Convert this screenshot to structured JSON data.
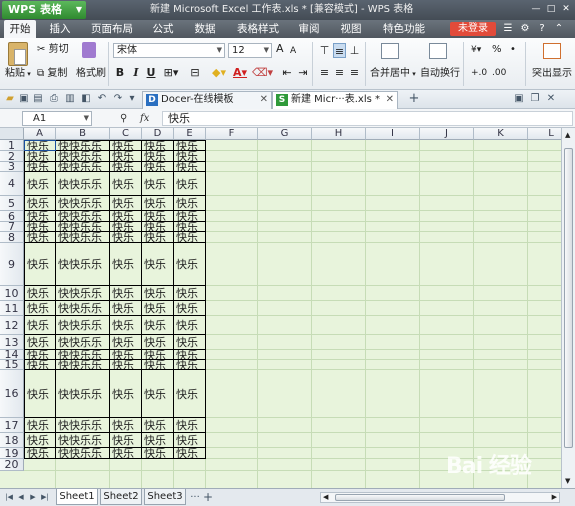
{
  "app": {
    "button_label": "WPS 表格",
    "window_title": "新建 Microsoft Excel 工作表.xls * [兼容模式] - WPS 表格"
  },
  "menu": {
    "tabs": [
      "开始",
      "插入",
      "页面布局",
      "公式",
      "数据",
      "表格样式",
      "审阅",
      "视图",
      "特色功能"
    ],
    "active_tab": "开始",
    "login_label": "未登录"
  },
  "ribbon": {
    "paste_label": "粘贴",
    "cut_label": "剪切",
    "copy_label": "复制",
    "format_painter_label": "格式刷",
    "font_name": "宋体",
    "font_size": "12",
    "bold": "B",
    "italic": "I",
    "underline": "U",
    "merge_center_label": "合并居中",
    "wrap_text_label": "自动换行",
    "percent_label": "%",
    "percent_sep": "•",
    "dec_increase": "+.0",
    "dec_decrease": ".00",
    "borders_label": "突出显示"
  },
  "doc_tabs": [
    {
      "label": "Docer-在线模板",
      "active": false
    },
    {
      "label": "新建 Micr···表.xls *",
      "active": true
    }
  ],
  "formula_bar": {
    "cell_ref": "A1",
    "fx": "fx",
    "value": "快乐"
  },
  "sheet": {
    "columns": [
      "A",
      "B",
      "C",
      "D",
      "E",
      "F",
      "G",
      "H",
      "I",
      "J",
      "K",
      "L"
    ],
    "rows": [
      {
        "num": "1",
        "cells": [
          "快乐",
          "快快乐乐",
          "快乐",
          "快乐",
          "快乐"
        ]
      },
      {
        "num": "2",
        "cells": [
          "快乐",
          "快快乐乐",
          "快乐",
          "快乐",
          "快乐"
        ]
      },
      {
        "num": "3",
        "cells": [
          "快乐",
          "快快乐乐",
          "快乐",
          "快乐",
          "快乐"
        ]
      },
      {
        "num": "4",
        "cells": [
          "快乐",
          "快快乐乐",
          "快乐",
          "快乐",
          "快乐"
        ]
      },
      {
        "num": "5",
        "cells": [
          "快乐",
          "快快乐乐",
          "快乐",
          "快乐",
          "快乐"
        ]
      },
      {
        "num": "6",
        "cells": [
          "快乐",
          "快快乐乐",
          "快乐",
          "快乐",
          "快乐"
        ]
      },
      {
        "num": "7",
        "cells": [
          "快乐",
          "快快乐乐",
          "快乐",
          "快乐",
          "快乐"
        ]
      },
      {
        "num": "8",
        "cells": [
          "快乐",
          "快快乐乐",
          "快乐",
          "快乐",
          "快乐"
        ]
      },
      {
        "num": "9",
        "cells": [
          "快乐",
          "快快乐乐",
          "快乐",
          "快乐",
          "快乐"
        ]
      },
      {
        "num": "10",
        "cells": [
          "快乐",
          "快快乐乐",
          "快乐",
          "快乐",
          "快乐"
        ]
      },
      {
        "num": "11",
        "cells": [
          "快乐",
          "快快乐乐",
          "快乐",
          "快乐",
          "快乐"
        ]
      },
      {
        "num": "12",
        "cells": [
          "快乐",
          "快快乐乐",
          "快乐",
          "快乐",
          "快乐"
        ]
      },
      {
        "num": "13",
        "cells": [
          "快乐",
          "快快乐乐",
          "快乐",
          "快乐",
          "快乐"
        ]
      },
      {
        "num": "14",
        "cells": [
          "快乐",
          "快快乐乐",
          "快乐",
          "快乐",
          "快乐"
        ]
      },
      {
        "num": "15",
        "cells": [
          "快乐",
          "快快乐乐",
          "快乐",
          "快乐",
          "快乐"
        ]
      },
      {
        "num": "16",
        "cells": [
          "快乐",
          "快快乐乐",
          "快乐",
          "快乐",
          "快乐"
        ]
      },
      {
        "num": "17",
        "cells": [
          "快乐",
          "快快乐乐",
          "快乐",
          "快乐",
          "快乐"
        ]
      },
      {
        "num": "18",
        "cells": [
          "快乐",
          "快快乐乐",
          "快乐",
          "快乐",
          "快乐"
        ]
      },
      {
        "num": "19",
        "cells": [
          "快乐",
          "快快乐乐",
          "快乐",
          "快乐",
          "快乐"
        ]
      },
      {
        "num": "20",
        "cells": []
      }
    ]
  },
  "sheet_tabs": [
    {
      "label": "Sheet1",
      "active": true
    },
    {
      "label": "Sheet2",
      "active": false
    },
    {
      "label": "Sheet3",
      "active": false
    }
  ],
  "sheet_more": "···",
  "add_sheet": "+",
  "watermark": "Bai 经验",
  "colors": {
    "cell_background": "#e8f4dc",
    "app_button": "#3a9a3a",
    "login_button": "#e24b3a"
  }
}
